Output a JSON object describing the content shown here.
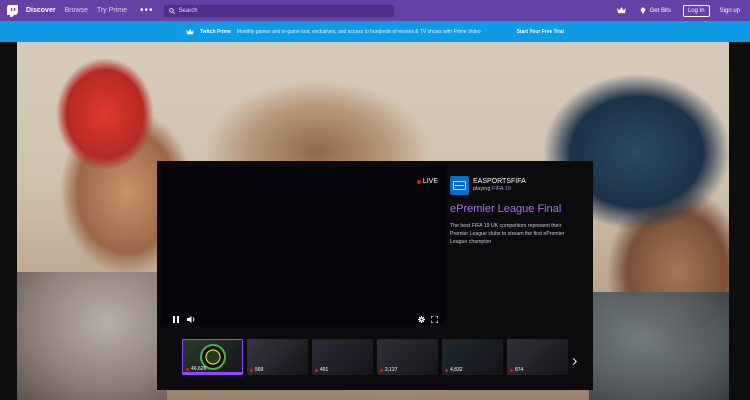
{
  "nav": {
    "links": [
      "Discover",
      "Browse",
      "Try Prime"
    ],
    "more": "•••",
    "search_placeholder": "Search",
    "bits_label": "Get Bits",
    "login_label": "Log In",
    "signup_label": "Sign up"
  },
  "prime": {
    "title": "Twitch Prime",
    "text": "Monthly games and in-game loot, exclusives, and access to hundreds of movies & TV shows with Prime Video",
    "cta": "Start Your Free Trial"
  },
  "player": {
    "live_label": "LIVE",
    "channel_name": "EASPORTSFIFA",
    "playing_prefix": "playing",
    "game": "FIFA 19",
    "title": "ePremier League Final",
    "description": "The best FIFA 19 UK competitors represent their Premier League clubs to stream the first ePremier League champion"
  },
  "carousel": {
    "thumbs": [
      {
        "viewers": "46,626",
        "active": true,
        "bg": "#2a3a2a"
      },
      {
        "viewers": "569",
        "active": false,
        "bg": "#3a3540"
      },
      {
        "viewers": "491",
        "active": false,
        "bg": "#2a2c38"
      },
      {
        "viewers": "2,127",
        "active": false,
        "bg": "#30303a"
      },
      {
        "viewers": "4,832",
        "active": false,
        "bg": "#1f2830"
      },
      {
        "viewers": "874",
        "active": false,
        "bg": "#34303a"
      }
    ]
  },
  "colors": {
    "twitch_purple": "#6441a4",
    "prime_blue": "#0f9ae6",
    "title_purple": "#a86ef2",
    "live_red": "#ec1313"
  }
}
